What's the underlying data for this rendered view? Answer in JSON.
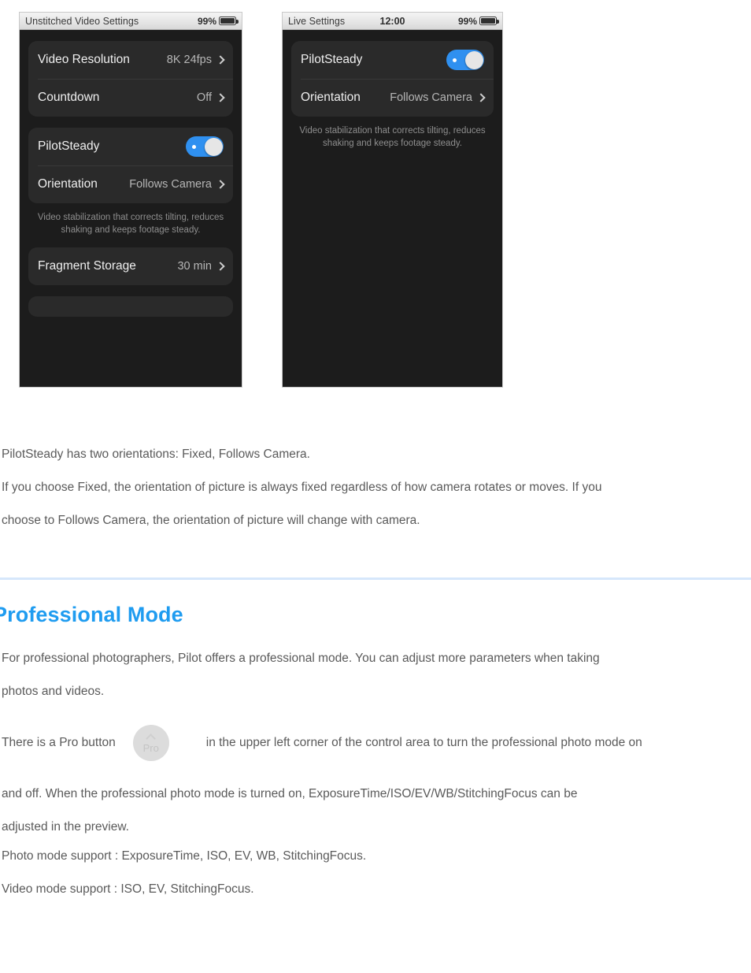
{
  "screenshots": [
    {
      "name": "unstitched-video-settings",
      "statusbar": {
        "title": "Unstitched Video Settings",
        "time": "",
        "battery_pct": "99%",
        "battery_icon": "battery-icon"
      },
      "cards": [
        {
          "rows": [
            {
              "type": "nav",
              "label": "Video Resolution",
              "value": "8K 24fps",
              "icon": "chevron-right-icon"
            },
            {
              "type": "nav",
              "label": "Countdown",
              "value": "Off",
              "icon": "chevron-right-icon"
            }
          ]
        },
        {
          "rows": [
            {
              "type": "toggle",
              "label": "PilotSteady",
              "value": "on",
              "icon": "toggle-switch-icon"
            },
            {
              "type": "nav",
              "label": "Orientation",
              "value": "Follows Camera",
              "icon": "chevron-right-icon"
            }
          ]
        }
      ],
      "hint": "Video stabilization that corrects tilting, reduces shaking and keeps footage steady.",
      "card_after_hint": {
        "rows": [
          {
            "type": "nav",
            "label": "Fragment Storage",
            "value": "30 min",
            "icon": "chevron-right-icon"
          }
        ]
      }
    },
    {
      "name": "live-settings",
      "statusbar": {
        "title": "Live Settings",
        "time": "12:00",
        "battery_pct": "99%",
        "battery_icon": "battery-icon"
      },
      "cards": [
        {
          "rows": [
            {
              "type": "toggle",
              "label": "PilotSteady",
              "value": "on",
              "icon": "toggle-switch-icon"
            },
            {
              "type": "nav",
              "label": "Orientation",
              "value": "Follows Camera",
              "icon": "chevron-right-icon"
            }
          ]
        }
      ],
      "hint": "Video stabilization that corrects tilting, reduces shaking and keeps footage steady."
    }
  ],
  "body": {
    "para_1": "PilotSteady has two orientations: Fixed, Follows Camera.",
    "para_2": "If you choose Fixed, the orientation of picture is always fixed regardless of how camera rotates or moves. If you",
    "para_3": "choose to Follows Camera, the orientation of picture will change with camera.",
    "heading": "Professional Mode",
    "para_4": "For professional photographers, Pilot offers a professional mode. You can adjust more parameters when taking",
    "para_5": "photos and videos.",
    "pro_line_before": "There is a Pro button",
    "pro_button_label": "Pro",
    "pro_button_icon": "chevron-up-icon",
    "pro_line_after": "in the upper left corner of the control area to turn the professional photo mode on",
    "para_6": "and off. When the professional photo mode is turned on, ExposureTime/ISO/EV/WB/StitchingFocus can be",
    "para_7": "adjusted in the preview.",
    "para_8": "Photo mode support : ExposureTime, ISO, EV, WB, StitchingFocus.",
    "para_9": "Video mode support : ISO, EV, StitchingFocus."
  },
  "colors": {
    "heading": "#1f9cf0",
    "divider": "#d6e7fb",
    "toggle_on": "#2f90f0",
    "body_text": "#5a5a5a",
    "screen_bg": "#1c1c1c",
    "card_bg": "#2a2a2a"
  }
}
